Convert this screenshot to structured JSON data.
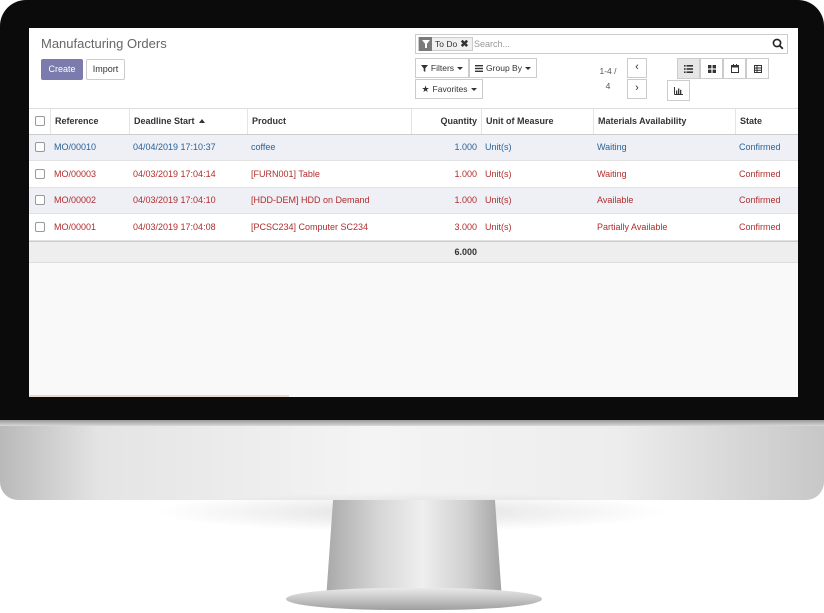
{
  "page": {
    "title": "Manufacturing Orders"
  },
  "buttons": {
    "create": "Create",
    "import": "Import"
  },
  "search": {
    "facet_label": "To Do",
    "facet_icon": "filter-icon",
    "facet_remove": "✖",
    "placeholder": "Search..."
  },
  "dropdowns": {
    "filters": "Filters",
    "group_by": "Group By",
    "favorites": "Favorites"
  },
  "pager": {
    "value": "1-4 /",
    "limit": "4",
    "prev": "‹",
    "next": "›"
  },
  "views": {
    "active": "list",
    "buttons": [
      "list-icon",
      "kanban-icon",
      "calendar-icon",
      "pivot-icon",
      "graph-icon"
    ]
  },
  "table": {
    "headers": {
      "reference": "Reference",
      "deadline": "Deadline Start",
      "product": "Product",
      "quantity": "Quantity",
      "uom": "Unit of Measure",
      "materials": "Materials Availability",
      "state": "State"
    },
    "rows": [
      {
        "reference": "MO/00010",
        "deadline": "04/04/2019 17:10:37",
        "product": "coffee",
        "quantity": "1.000",
        "uom": "Unit(s)",
        "materials": "Waiting",
        "state": "Confirmed"
      },
      {
        "reference": "MO/00003",
        "deadline": "04/03/2019 17:04:14",
        "product": "[FURN001] Table",
        "quantity": "1.000",
        "uom": "Unit(s)",
        "materials": "Waiting",
        "state": "Confirmed"
      },
      {
        "reference": "MO/00002",
        "deadline": "04/03/2019 17:04:10",
        "product": "[HDD-DEM] HDD on Demand",
        "quantity": "1.000",
        "uom": "Unit(s)",
        "materials": "Available",
        "state": "Confirmed"
      },
      {
        "reference": "MO/00001",
        "deadline": "04/03/2019 17:04:08",
        "product": "[PCSC234] Computer SC234",
        "quantity": "3.000",
        "uom": "Unit(s)",
        "materials": "Partially Available",
        "state": "Confirmed"
      }
    ],
    "total_quantity": "6.000"
  },
  "colors": {
    "primary": "#7c7bad",
    "link_blue": "#2a6496",
    "late_red": "#b02d2d"
  }
}
